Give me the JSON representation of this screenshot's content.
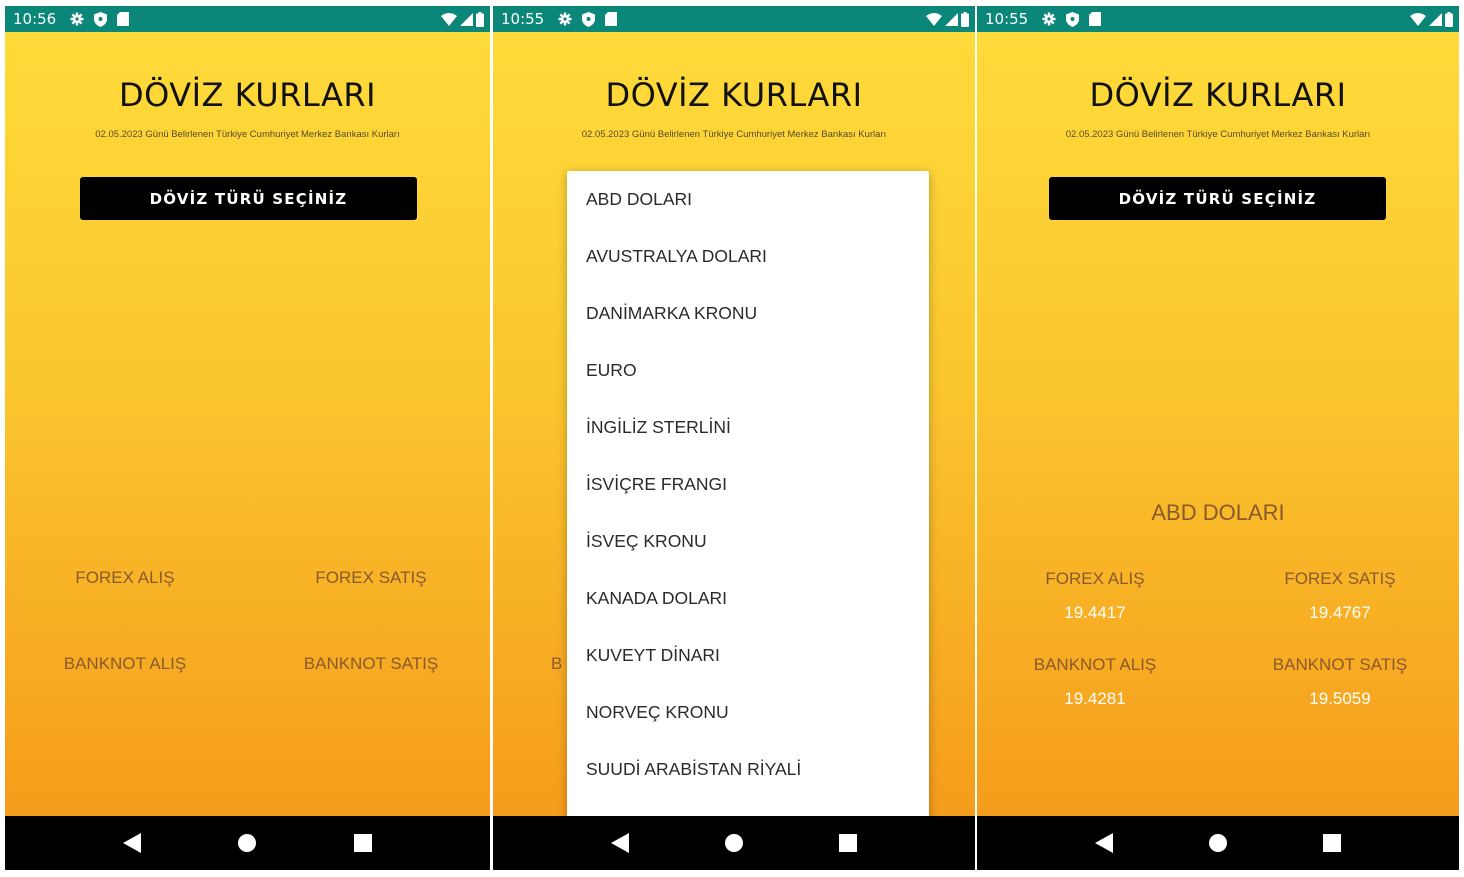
{
  "screens": [
    {
      "time": "10:56",
      "title": "DÖVİZ KURLARI",
      "subtitle": "02.05.2023 Günü Belirlenen Türkiye Cumhuriyet Merkez Bankası Kurları",
      "select_button": "DÖVİZ TÜRÜ SEÇİNİZ",
      "labels": {
        "forex_buy": "FOREX ALIŞ",
        "forex_sell": "FOREX SATIŞ",
        "banknote_buy": "BANKNOT ALIŞ",
        "banknote_sell": "BANKNOT SATIŞ"
      }
    },
    {
      "time": "10:55",
      "title": "DÖVİZ KURLARI",
      "subtitle": "02.05.2023 Günü Belirlenen Türkiye Cumhuriyet Merkez Bankası Kurları",
      "peek_label": "B",
      "dropdown_items": [
        "ABD DOLARI",
        "AVUSTRALYA DOLARI",
        "DANİMARKA KRONU",
        "EURO",
        "İNGİLİZ STERLİNİ",
        "İSVİÇRE FRANGI",
        "İSVEÇ KRONU",
        "KANADA DOLARI",
        "KUVEYT DİNARI",
        "NORVEÇ KRONU",
        "SUUDİ ARABİSTAN RİYALİ"
      ]
    },
    {
      "time": "10:55",
      "title": "DÖVİZ KURLARI",
      "subtitle": "02.05.2023 Günü Belirlenen Türkiye Cumhuriyet Merkez Bankası Kurları",
      "select_button": "DÖVİZ TÜRÜ SEÇİNİZ",
      "currency": "ABD DOLARI",
      "labels": {
        "forex_buy": "FOREX ALIŞ",
        "forex_sell": "FOREX SATIŞ",
        "banknote_buy": "BANKNOT ALIŞ",
        "banknote_sell": "BANKNOT SATIŞ"
      },
      "values": {
        "forex_buy": "19.4417",
        "forex_sell": "19.4767",
        "banknote_buy": "19.4281",
        "banknote_sell": "19.5059"
      }
    }
  ],
  "status_icons": [
    "gear-icon",
    "shield-icon",
    "sd-card-icon"
  ],
  "status_right_icons": [
    "wifi-icon",
    "signal-icon",
    "battery-icon"
  ],
  "nav_icons": [
    "back-icon",
    "home-icon",
    "recents-icon"
  ],
  "colors": {
    "status_bar": "#0b877a",
    "gradient_top": "#fedb3a",
    "gradient_bottom": "#f59c1c",
    "label_text": "#8a5a2e",
    "value_text": "#ffffff",
    "button_bg": "#000000"
  }
}
